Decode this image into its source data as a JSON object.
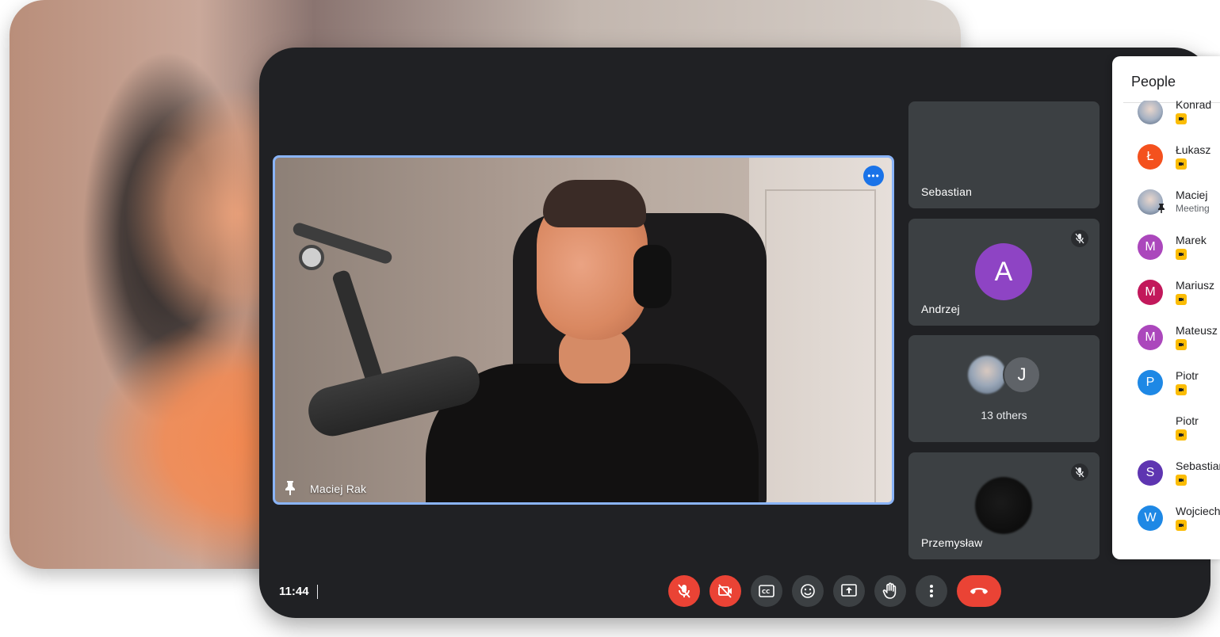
{
  "meeting": {
    "main_video": {
      "participant_name": "Maciej Rak"
    },
    "tiles": [
      {
        "name": "Sebastian",
        "muted": false
      },
      {
        "name": "Andrzej",
        "avatar_letter": "A",
        "avatar_color": "#8e44c4",
        "muted": true
      },
      {
        "others_letter": "J",
        "others_label": "13 others"
      },
      {
        "name": "Przemysław",
        "muted": true
      }
    ],
    "clock": "11:44",
    "controls": [
      {
        "id": "mic",
        "icon": "mic-off-icon",
        "state": "off"
      },
      {
        "id": "camera",
        "icon": "camera-off-icon",
        "state": "off"
      },
      {
        "id": "captions",
        "icon": "captions-icon"
      },
      {
        "id": "reactions",
        "icon": "emoji-icon"
      },
      {
        "id": "present",
        "icon": "present-screen-icon"
      },
      {
        "id": "raise-hand",
        "icon": "hand-icon"
      },
      {
        "id": "more",
        "icon": "more-vert-icon"
      },
      {
        "id": "leave",
        "icon": "end-call-icon"
      }
    ]
  },
  "people_panel": {
    "title": "People",
    "participants": [
      {
        "name": "Konrad",
        "avatar_type": "photo"
      },
      {
        "name": "Łukasz",
        "avatar_letter": "Ł",
        "avatar_color": "#f4511e"
      },
      {
        "name": "Maciej",
        "subtitle": "Meeting",
        "avatar_type": "photo",
        "pinned": true
      },
      {
        "name": "Marek",
        "avatar_letter": "M",
        "avatar_color": "#ab47bc"
      },
      {
        "name": "Mariusz",
        "avatar_letter": "M",
        "avatar_color": "#c2185b"
      },
      {
        "name": "Mateusz",
        "avatar_letter": "M",
        "avatar_color": "#ab47bc"
      },
      {
        "name": "Piotr",
        "avatar_letter": "P",
        "avatar_color": "#1e88e5"
      },
      {
        "name": "Piotr",
        "avatar_type": "none"
      },
      {
        "name": "Sebastian",
        "avatar_letter": "S",
        "avatar_color": "#5e35b1"
      },
      {
        "name": "Wojciech",
        "avatar_letter": "W",
        "avatar_color": "#1e88e5"
      }
    ]
  }
}
